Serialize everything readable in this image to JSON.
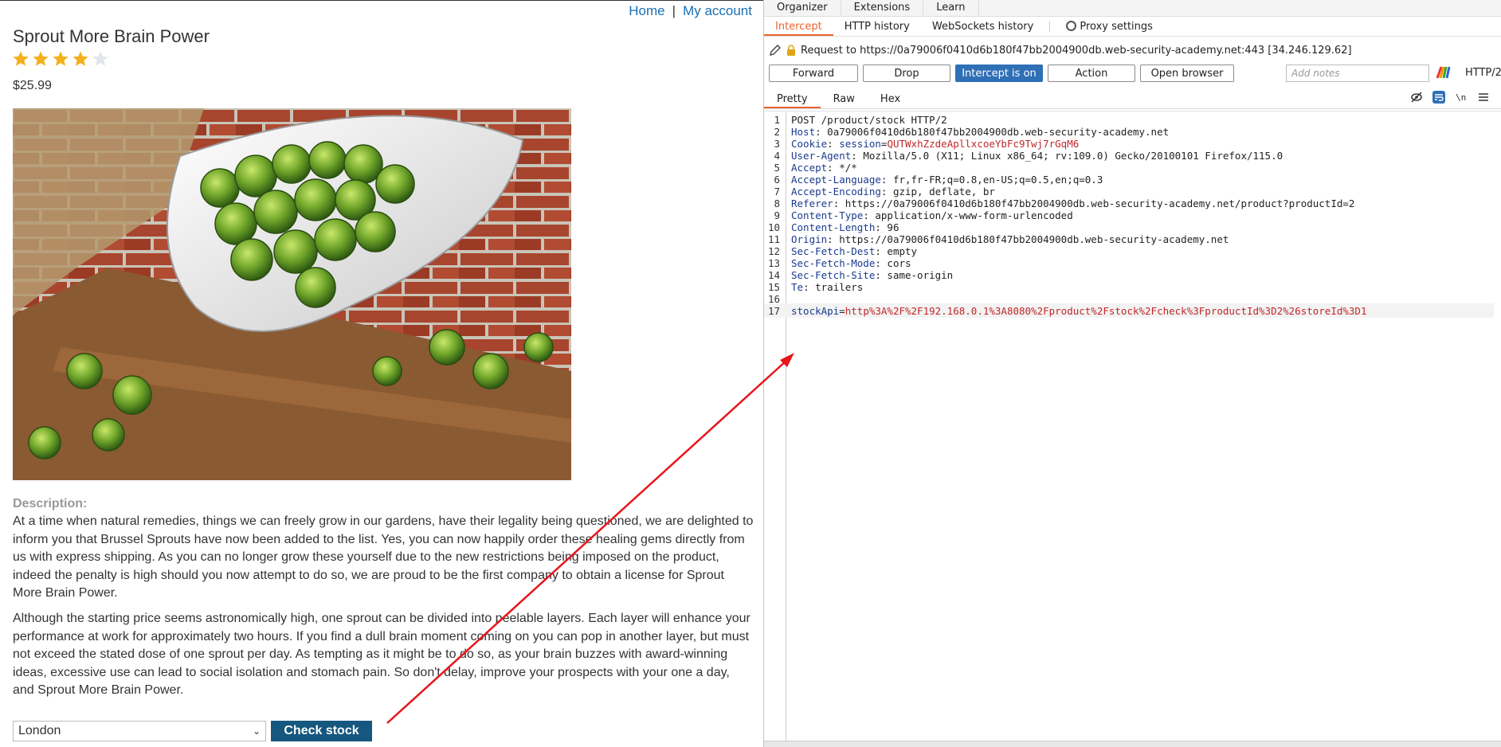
{
  "shop": {
    "nav": {
      "home": "Home",
      "separator": "|",
      "account": "My account"
    },
    "product_title": "Sprout More Brain Power",
    "rating": {
      "value": 4,
      "max": 5
    },
    "price": "$25.99",
    "description_label": "Description:",
    "description_p1": "At a time when natural remedies, things we can freely grow in our gardens, have their legality being questioned, we are delighted to inform you that Brussel Sprouts have now been added to the list. Yes, you can now happily order these healing gems directly from us with express shipping. As you can no longer grow these yourself due to the new restrictions being imposed on the product, indeed the penalty is high should you now attempt to do so, we are proud to be the first company to obtain a license for Sprout More Brain Power.",
    "description_p2": "Although the starting price seems astronomically high, one sprout can be divided into peelable layers. Each layer will enhance your performance at work for approximately two hours. If you find a dull brain moment coming on you can pop in another layer, but must not exceed the stated dose of one sprout per day. As tempting as it might be to do so, as your brain buzzes with award-winning ideas, excessive use can lead to social isolation and stomach pain. So don't delay, improve your prospects with your one a day, and Sprout More Brain Power.",
    "store_select": {
      "selected": "London"
    },
    "check_stock_label": "Check stock"
  },
  "proxy": {
    "top_menu": [
      "Organizer",
      "Extensions",
      "Learn"
    ],
    "sub_tabs": {
      "intercept": "Intercept",
      "http_history": "HTTP history",
      "ws_history": "WebSockets history",
      "settings": "Proxy settings"
    },
    "request_line": "Request to https://0a79006f0410d6b180f47bb2004900db.web-security-academy.net:443  [34.246.129.62]",
    "buttons": {
      "forward": "Forward",
      "drop": "Drop",
      "intercept": "Intercept is on",
      "action": "Action",
      "open_browser": "Open browser"
    },
    "notes_placeholder": "Add notes",
    "http_version": "HTTP/2",
    "view_tabs": {
      "pretty": "Pretty",
      "raw": "Raw",
      "hex": "Hex"
    },
    "request": {
      "request_line": "POST /product/stock HTTP/2",
      "headers": [
        {
          "name": "Host",
          "value": "0a79006f0410d6b180f47bb2004900db.web-security-academy.net"
        },
        {
          "name": "Cookie",
          "value": "session=QUTWxhZzdeApllxcoeYbFc9Twj7rGqM6"
        },
        {
          "name": "User-Agent",
          "value": "Mozilla/5.0 (X11; Linux x86_64; rv:109.0) Gecko/20100101 Firefox/115.0"
        },
        {
          "name": "Accept",
          "value": "*/*"
        },
        {
          "name": "Accept-Language",
          "value": "fr,fr-FR;q=0.8,en-US;q=0.5,en;q=0.3"
        },
        {
          "name": "Accept-Encoding",
          "value": "gzip, deflate, br"
        },
        {
          "name": "Referer",
          "value": "https://0a79006f0410d6b180f47bb2004900db.web-security-academy.net/product?productId=2"
        },
        {
          "name": "Content-Type",
          "value": "application/x-www-form-urlencoded"
        },
        {
          "name": "Content-Length",
          "value": "96"
        },
        {
          "name": "Origin",
          "value": "https://0a79006f0410d6b180f47bb2004900db.web-security-academy.net"
        },
        {
          "name": "Sec-Fetch-Dest",
          "value": "empty"
        },
        {
          "name": "Sec-Fetch-Mode",
          "value": "cors"
        },
        {
          "name": "Sec-Fetch-Site",
          "value": "same-origin"
        },
        {
          "name": "Te",
          "value": "trailers"
        }
      ],
      "body_param": "stockApi",
      "body_value": "http%3A%2F%2F192.168.0.1%3A8080%2Fproduct%2Fstock%2Fcheck%3FproductId%3D2%26storeId%3D1"
    }
  },
  "colors": {
    "accent_orange": "#e8642c",
    "link_blue": "#1a6fb5",
    "check_button": "#15577e",
    "intercept_on": "#2f6fb6",
    "annotation_arrow": "#e8141c"
  }
}
